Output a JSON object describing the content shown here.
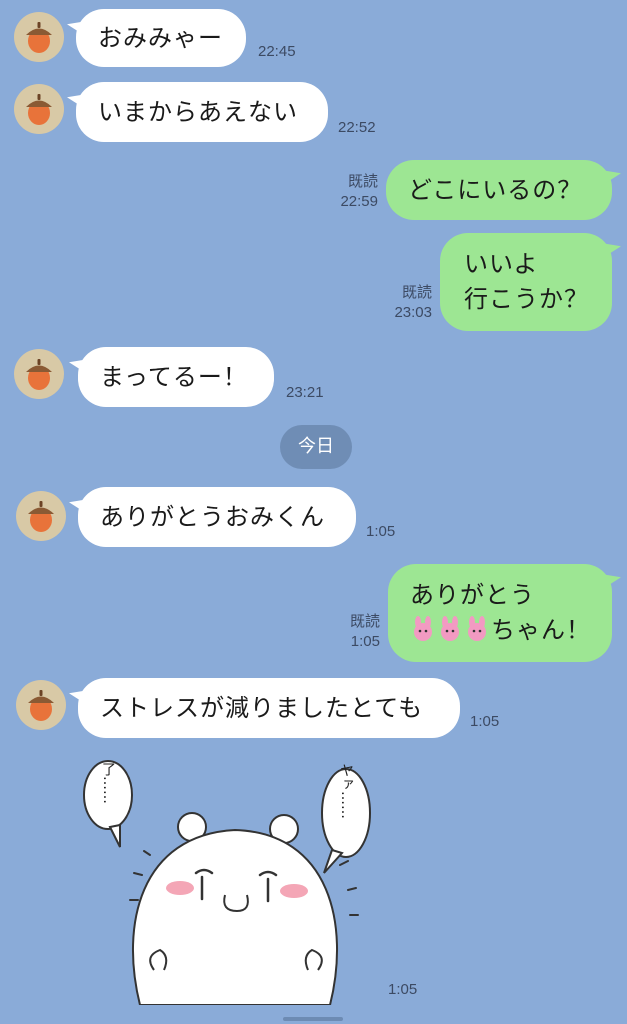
{
  "messages": [
    {
      "text": "おみみゃー",
      "time": "22:45"
    },
    {
      "text": "いまからあえない",
      "time": "22:52"
    },
    {
      "text": "どこにいるの？",
      "read": "既読",
      "time": "22:59"
    },
    {
      "line1": "いいよ",
      "line2": "行こうか？",
      "read": "既読",
      "time": "23:03"
    },
    {
      "text": "まってるー！",
      "time": "23:21"
    },
    {
      "text": "ありがとうおみくん",
      "time": "1:05"
    },
    {
      "line1": "ありがとう",
      "line2_suffix": "ちゃん！",
      "read": "既読",
      "time": "1:05"
    },
    {
      "text": "ストレスが減りましたとても",
      "time": "1:05"
    },
    {
      "time": "1:05"
    }
  ],
  "day_separator": "今日",
  "sticker": {
    "left_balloon": "了……",
    "right_balloon": "ヤァ……"
  },
  "colors": {
    "background": "#8aabd8",
    "incoming_bubble": "#ffffff",
    "outgoing_bubble": "#9de693",
    "avatar_bg": "#d8c9a6",
    "acorn": "#e8733a"
  },
  "icons": {
    "avatar": "acorn-icon",
    "emoji": "pink-rabbit-emoji"
  }
}
